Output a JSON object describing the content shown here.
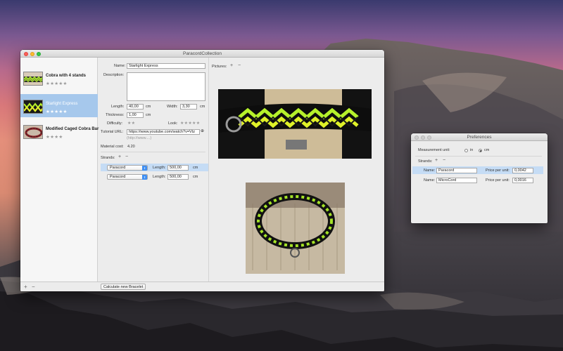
{
  "main_window": {
    "title": "ParacordCollection",
    "sidebar": {
      "items": [
        {
          "name": "Cobra with 4 stands",
          "stars": "★★★★★"
        },
        {
          "name": "Starlight Express",
          "stars": "★★★★★"
        },
        {
          "name": "Modified Caged Cobra Bar",
          "stars": "★★★★"
        }
      ]
    },
    "detail": {
      "name_label": "Name:",
      "name_value": "Starlight Express",
      "description_label": "Description:",
      "length_label": "Length:",
      "length_value": "40,00",
      "length_unit": "cm",
      "width_label": "Width:",
      "width_value": "3,30",
      "width_unit": "cm",
      "thickness_label": "Thickness:",
      "thickness_value": "1,00",
      "thickness_unit": "cm",
      "difficulty_label": "Difficulty:",
      "difficulty_stars": "★★",
      "look_label": "Look:",
      "look_stars": "★★★★★",
      "tutorial_label": "Tutorial URL:",
      "tutorial_value": "https://www.youtube.com/watch?v=Vtz",
      "tutorial_placeholder": "(http://www....)",
      "material_cost_label": "Material cost:",
      "material_cost_value": "4.20",
      "strands_label": "Strands:",
      "strands": [
        {
          "type": "Paracord",
          "length_label": "Length:",
          "length": "500,00",
          "unit": "cm"
        },
        {
          "type": "Paracord",
          "length_label": "Length:",
          "length": "500,00",
          "unit": "cm"
        }
      ]
    },
    "pictures_label": "Pictures:",
    "bottom": {
      "plus": "+",
      "minus": "−",
      "calculate_button": "Calculate new Bracelet"
    }
  },
  "prefs_window": {
    "title": "Preferences",
    "measurement_label": "Measurement unit:",
    "unit_options": [
      "in",
      "cm"
    ],
    "selected_unit": "cm",
    "strands_label": "Strands:",
    "rows": [
      {
        "name_label": "Name:",
        "name": "Paracord",
        "price_label": "Price per unit:",
        "price": "0,0042"
      },
      {
        "name_label": "Name:",
        "name": "MicroCord",
        "price_label": "Price per unit:",
        "price": "0,0016"
      }
    ]
  },
  "colors": {
    "selection": "#a6c8ec",
    "row_selection": "#c5dcf5",
    "popup_accent": "#3f8ff3"
  }
}
